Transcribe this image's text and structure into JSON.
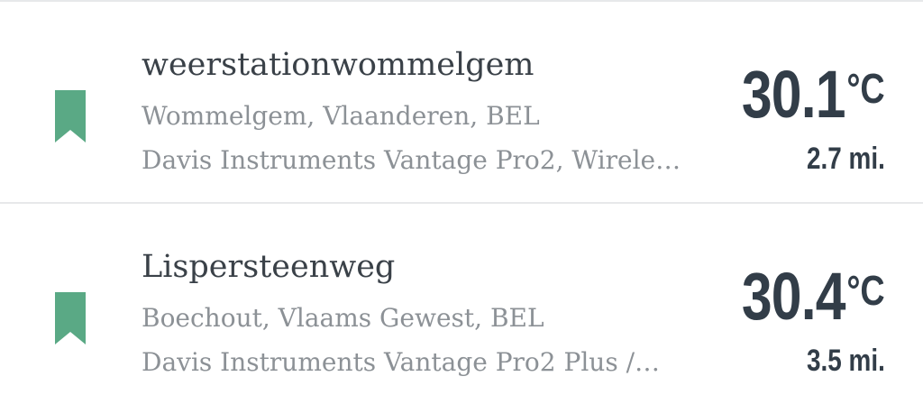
{
  "colors": {
    "bookmark": "#5aa985",
    "title_text": "#3a4148",
    "secondary_text": "#8c9196",
    "value_text": "#323d48",
    "divider": "#e7e8ea"
  },
  "stations": [
    {
      "icon": "bookmark-icon",
      "name": "weerstationwommelgem",
      "location": "Wommelgem, Vlaanderen, BEL",
      "model": "Davis Instruments Vantage Pro2, Wirele…",
      "temperature": "30.1",
      "temperature_unit": "°C",
      "distance": "2.7 mi."
    },
    {
      "icon": "bookmark-icon",
      "name": "Lispersteenweg",
      "location": "Boechout, Vlaams Gewest, BEL",
      "model": "Davis Instruments Vantage Pro2 Plus /…",
      "temperature": "30.4",
      "temperature_unit": "°C",
      "distance": "3.5 mi."
    }
  ]
}
